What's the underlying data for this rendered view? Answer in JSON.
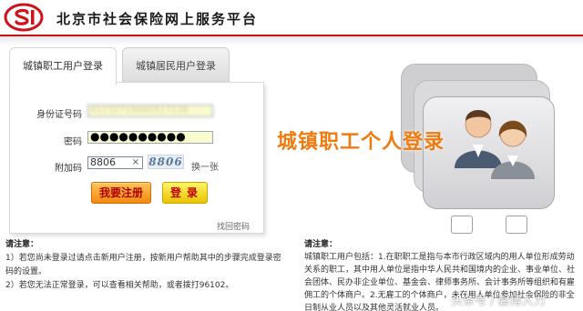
{
  "header": {
    "site_title": "北京市社会保险网上服务平台",
    "brand_color": "#c8101a"
  },
  "login": {
    "tabs": [
      {
        "label": "城镇职工用户登录",
        "active": true
      },
      {
        "label": "城镇居民用户登录",
        "active": false
      }
    ],
    "id_label": "身份证号码",
    "id_value": "41232719860517136",
    "password_label": "密码",
    "password_value": "●●●●●●●●●●",
    "captcha_label": "附加码",
    "captcha_value": "8806",
    "captcha_clear": "×",
    "captcha_image_text": "8806",
    "captcha_swap": "换一张",
    "register_button": "我要注册",
    "login_button": "登录",
    "forgot_link": "找回密码"
  },
  "promo": {
    "text": "城镇职工个人登录",
    "text_color": "#f07c10",
    "icon": "user-card-icon"
  },
  "notes_left": {
    "heading": "请注意：",
    "items": [
      "1）若您尚未登录过请点击新用户注册，按新用户帮助其中的步骤完成登录密码的设置。",
      "2）若您无法正常登录，可以查看相关帮助，或者拨打96102。"
    ]
  },
  "notes_right": {
    "heading": "请注意：",
    "body": "城镇职工用户包括：1.在职职工是指与本市行政区域内的用人单位形成劳动关系的职工，其中用人单位是指中华人民共和国境内的企业、事业单位、社会团体、民办非企业单位、基金会、律师事务所、会计事务所等组织和有雇佣工的个体商户。2.无雇工的个体商户，未在用人单位参加社会保险的非全日制从业人员以及其他灵活就业人员。"
  },
  "watermark": "头条号 / 磐博人力"
}
